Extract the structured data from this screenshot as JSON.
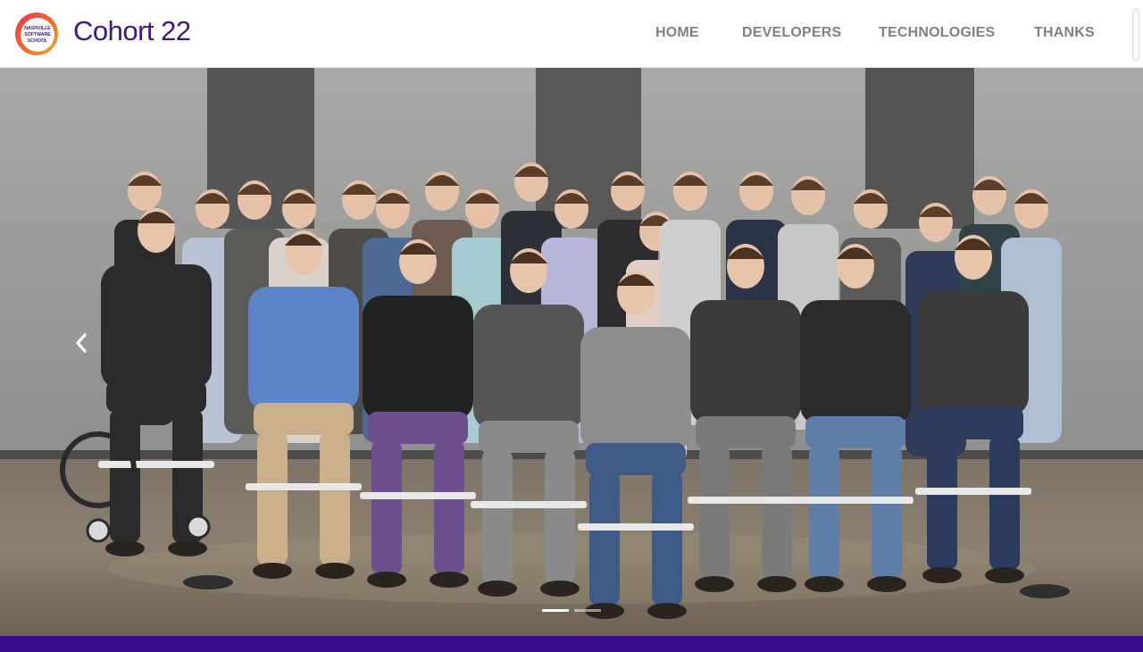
{
  "brand": {
    "title": "Cohort 22",
    "logo_text": [
      "NASHVILLE",
      "SOFTWARE",
      "SCHOOL"
    ]
  },
  "nav": {
    "items": [
      {
        "label": "HOME",
        "active": true
      },
      {
        "label": "DEVELOPERS",
        "active": false
      },
      {
        "label": "TECHNOLOGIES",
        "active": false
      },
      {
        "label": "THANKS",
        "active": false
      }
    ]
  },
  "carousel": {
    "slide_alt": "Cohort 22 group photo",
    "prev_icon": "chevron-left-icon",
    "indicator_count": 2,
    "active_index": 0
  },
  "colors": {
    "brand_purple": "#3d1489",
    "footer_purple": "#3a0c8a",
    "nav_active": "#111111",
    "nav_inactive": "#808080"
  }
}
